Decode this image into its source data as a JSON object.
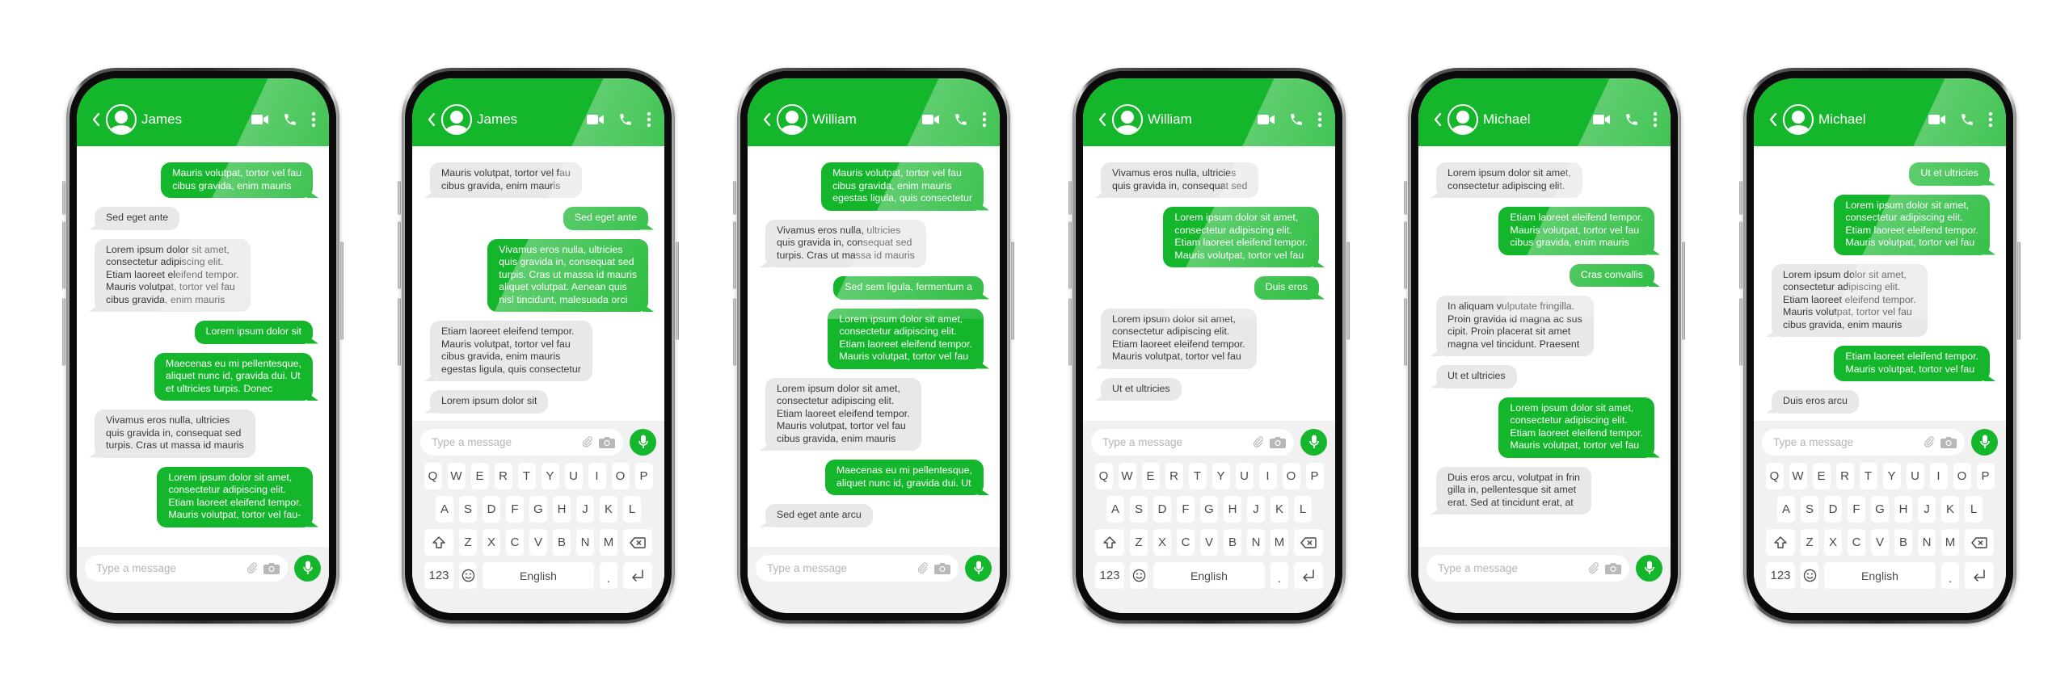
{
  "colors": {
    "accent": "#14b62b",
    "incoming_bubble": "#e8e8e8",
    "incoming_text": "#3a3a3a",
    "input_area": "#f1f1f1"
  },
  "icons": {
    "back": "chevron-left-icon",
    "avatar": "user-avatar-icon",
    "video": "video-camera-icon",
    "call": "phone-icon",
    "more": "more-vertical-icon",
    "attach": "paperclip-icon",
    "camera": "camera-icon",
    "mic": "microphone-icon",
    "shift": "shift-icon",
    "backspace": "backspace-icon",
    "emoji": "emoji-icon",
    "enter": "enter-icon"
  },
  "input": {
    "placeholder": "Type a message"
  },
  "keyboard": {
    "row1": [
      "Q",
      "W",
      "E",
      "R",
      "T",
      "Y",
      "U",
      "I",
      "O",
      "P"
    ],
    "row2": [
      "A",
      "S",
      "D",
      "F",
      "G",
      "H",
      "J",
      "K",
      "L"
    ],
    "row3": [
      "Z",
      "X",
      "C",
      "V",
      "B",
      "N",
      "M"
    ],
    "numbers_label": "123",
    "space_label": "English",
    "period_label": "."
  },
  "phones": [
    {
      "contact": "James",
      "keyboard_visible": false,
      "messages": [
        {
          "dir": "out",
          "lines": [
            "Mauris volutpat, tortor vel fau",
            "cibus gravida, enim mauris"
          ]
        },
        {
          "dir": "in",
          "lines": [
            "Sed eget ante"
          ]
        },
        {
          "dir": "in",
          "lines": [
            "Lorem ipsum dolor sit amet,",
            "consectetur adipiscing elit.",
            "Etiam laoreet eleifend tempor.",
            "Mauris volutpat, tortor vel fau",
            "cibus gravida, enim mauris"
          ]
        },
        {
          "dir": "out",
          "lines": [
            "Lorem ipsum dolor sit"
          ]
        },
        {
          "dir": "out",
          "lines": [
            "Maecenas eu mi pellentesque,",
            "aliquet nunc id, gravida dui. Ut",
            "et ultricies turpis. Donec"
          ]
        },
        {
          "dir": "in",
          "lines": [
            "Vivamus eros nulla, ultricies",
            "quis gravida in, consequat sed",
            "turpis. Cras ut massa id mauris"
          ]
        },
        {
          "dir": "out",
          "lines": [
            "Lorem ipsum dolor sit amet,",
            "consectetur adipiscing elit.",
            "Etiam laoreet eleifend tempor.",
            "Mauris volutpat, tortor vel fau-"
          ]
        }
      ]
    },
    {
      "contact": "James",
      "keyboard_visible": true,
      "messages": [
        {
          "dir": "in",
          "lines": [
            "Mauris volutpat, tortor vel fau",
            "cibus gravida, enim mauris"
          ]
        },
        {
          "dir": "out",
          "lines": [
            "Sed eget ante"
          ]
        },
        {
          "dir": "out",
          "lines": [
            "Vivamus eros nulla, ultricies",
            "quis gravida in, consequat sed",
            "turpis. Cras ut massa id mauris",
            "aliquet volutpat. Aenean quis",
            "nisl tincidunt, malesuada orci"
          ]
        },
        {
          "dir": "in",
          "lines": [
            "Etiam laoreet eleifend tempor.",
            "Mauris volutpat, tortor vel fau",
            "cibus gravida, enim mauris",
            "egestas ligula, quis consectetur"
          ]
        },
        {
          "dir": "in",
          "lines": [
            "Lorem ipsum dolor sit"
          ]
        }
      ]
    },
    {
      "contact": "William",
      "keyboard_visible": false,
      "messages": [
        {
          "dir": "out",
          "lines": [
            "Mauris volutpat, tortor vel fau",
            "cibus gravida, enim mauris",
            "egestas ligula, quis consectetur"
          ]
        },
        {
          "dir": "in",
          "lines": [
            "Vivamus eros nulla, ultricies",
            "quis gravida in, consequat sed",
            "turpis. Cras ut massa id mauris"
          ]
        },
        {
          "dir": "out",
          "lines": [
            "Sed sem ligula, fermentum a"
          ]
        },
        {
          "dir": "out",
          "lines": [
            "Lorem ipsum dolor sit amet,",
            "consectetur adipiscing elit.",
            "Etiam laoreet eleifend tempor.",
            "Mauris volutpat, tortor vel fau"
          ]
        },
        {
          "dir": "in",
          "lines": [
            "Lorem ipsum dolor sit amet,",
            "consectetur adipiscing elit.",
            "Etiam laoreet eleifend tempor.",
            "Mauris volutpat, tortor vel fau",
            "cibus gravida, enim mauris"
          ]
        },
        {
          "dir": "out",
          "lines": [
            "Maecenas eu mi pellentesque,",
            "aliquet nunc id, gravida dui. Ut"
          ]
        },
        {
          "dir": "in",
          "lines": [
            "Sed eget ante arcu"
          ]
        }
      ]
    },
    {
      "contact": "William",
      "keyboard_visible": true,
      "messages": [
        {
          "dir": "in",
          "lines": [
            "Vivamus eros nulla, ultricies",
            "quis gravida in, consequat sed"
          ]
        },
        {
          "dir": "out",
          "lines": [
            "Lorem ipsum dolor sit amet,",
            "consectetur adipiscing elit.",
            "Etiam laoreet eleifend tempor.",
            "Mauris volutpat, tortor vel fau"
          ]
        },
        {
          "dir": "out",
          "lines": [
            "Duis eros"
          ]
        },
        {
          "dir": "in",
          "lines": [
            "Lorem ipsum dolor sit amet,",
            "consectetur adipiscing elit.",
            "Etiam laoreet eleifend tempor.",
            "Mauris volutpat, tortor vel fau"
          ]
        },
        {
          "dir": "in",
          "lines": [
            "Ut et ultricies"
          ]
        }
      ]
    },
    {
      "contact": "Michael",
      "keyboard_visible": false,
      "messages": [
        {
          "dir": "in",
          "lines": [
            "Lorem ipsum dolor sit amet,",
            "consectetur adipiscing elit."
          ]
        },
        {
          "dir": "out",
          "lines": [
            "Etiam laoreet eleifend tempor.",
            "Mauris volutpat, tortor vel fau",
            "cibus gravida, enim mauris"
          ]
        },
        {
          "dir": "out",
          "lines": [
            "Cras convallis"
          ]
        },
        {
          "dir": "in",
          "lines": [
            "In aliquam vulputate fringilla.",
            "Proin gravida id magna ac sus",
            "cipit. Proin placerat sit amet",
            "magna vel tincidunt. Praesent"
          ]
        },
        {
          "dir": "in",
          "lines": [
            "Ut et ultricies"
          ]
        },
        {
          "dir": "out",
          "lines": [
            "Lorem ipsum dolor sit amet,",
            "consectetur adipiscing elit.",
            "Etiam laoreet eleifend tempor.",
            "Mauris volutpat, tortor vel fau"
          ]
        },
        {
          "dir": "in",
          "lines": [
            "Duis eros arcu, volutpat in frin",
            "gilla in, pellentesque sit amet",
            "erat. Sed at tincidunt erat, at"
          ]
        }
      ]
    },
    {
      "contact": "Michael",
      "keyboard_visible": true,
      "messages": [
        {
          "dir": "out",
          "lines": [
            "Ut et ultricies"
          ]
        },
        {
          "dir": "out",
          "lines": [
            "Lorem ipsum dolor sit amet,",
            "consectetur adipiscing elit.",
            "Etiam laoreet eleifend tempor.",
            "Mauris volutpat, tortor vel fau"
          ]
        },
        {
          "dir": "in",
          "lines": [
            "Lorem ipsum dolor sit amet,",
            "consectetur adipiscing elit.",
            "Etiam laoreet eleifend tempor.",
            "Mauris volutpat, tortor vel fau",
            "cibus gravida, enim mauris"
          ]
        },
        {
          "dir": "out",
          "lines": [
            "Etiam laoreet eleifend tempor.",
            "Mauris volutpat, tortor vel fau"
          ]
        },
        {
          "dir": "in",
          "lines": [
            "Duis eros arcu"
          ]
        }
      ]
    }
  ]
}
